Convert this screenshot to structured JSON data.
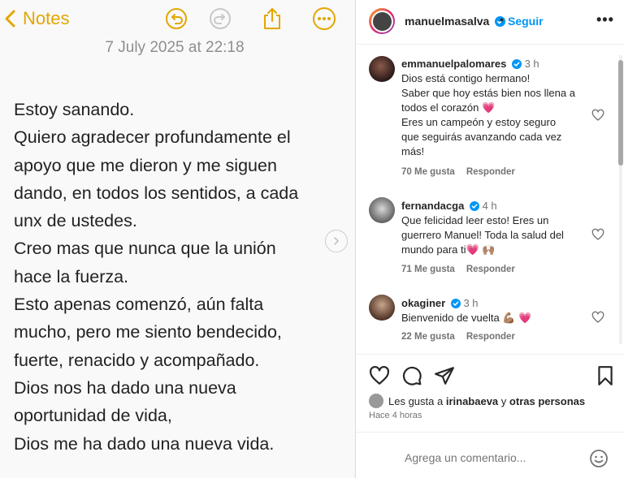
{
  "notes": {
    "back_label": "Notes",
    "date": "7 July 2025 at 22:18",
    "lines": [
      "Estoy sanando.",
      "Quiero agradecer profundamente el",
      "apoyo que me dieron y me siguen",
      "dando, en todos los sentidos, a cada",
      "unx de ustedes.",
      "Creo mas que nunca que la unión",
      "hace la fuerza.",
      "Esto apenas comenzó, aún falta",
      "mucho, pero me siento bendecido,",
      "fuerte, renacido y acompañado.",
      "Dios nos ha dado una nueva",
      "oportunidad de vida,",
      "Dios me ha dado una nueva vida."
    ],
    "accent_color": "#e3a600"
  },
  "post": {
    "username": "manuelmasalva",
    "separator": "•",
    "follow_label": "Seguir",
    "more_label": "•••",
    "comments": [
      {
        "username": "emmanuelpalomares",
        "time": "3 h",
        "lines": [
          "Dios está contigo hermano!",
          "Saber que hoy estás bien nos llena a",
          "todos el corazón 💗",
          "Eres un campeón y estoy seguro",
          "que seguirás avanzando cada vez",
          "más!"
        ],
        "likes": "70 Me gusta",
        "reply": "Responder"
      },
      {
        "username": "fernandacga",
        "time": "4 h",
        "lines": [
          "Que felicidad leer esto! Eres un",
          "guerrero Manuel! Toda la salud del",
          "mundo para ti💗 🙌🏽"
        ],
        "likes": "71 Me gusta",
        "reply": "Responder"
      },
      {
        "username": "okaginer",
        "time": "3 h",
        "lines": [
          "Bienvenido de vuelta 💪🏽 💗"
        ],
        "likes": "22 Me gusta",
        "reply": "Responder"
      }
    ],
    "liked_by_prefix": "Les gusta a",
    "liked_by_user": "irinabaeva",
    "liked_by_and": "y",
    "liked_by_others": "otras personas",
    "time_ago": "Hace 4 horas",
    "comment_placeholder": "Agrega un comentario...",
    "link_color": "#0095f6"
  }
}
